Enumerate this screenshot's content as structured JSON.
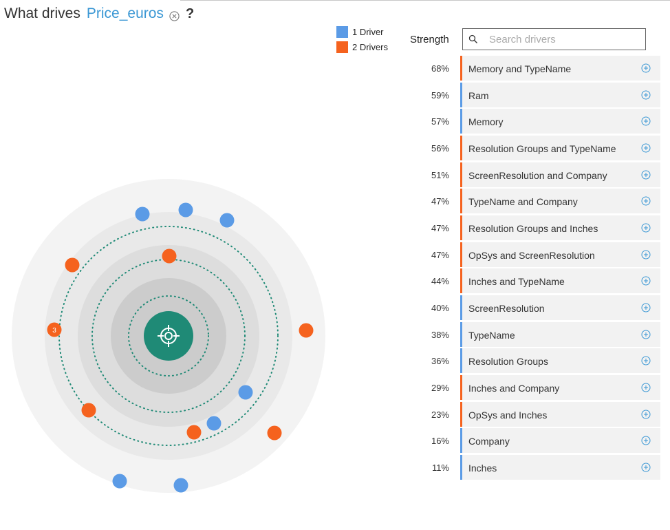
{
  "header": {
    "prefix": "What drives",
    "target": "Price_euros",
    "suffix": "?"
  },
  "legend": [
    {
      "label": "1 Driver",
      "color": "#5b9be6"
    },
    {
      "label": "2 Drivers",
      "color": "#f5621e"
    }
  ],
  "strength_label": "Strength",
  "search": {
    "placeholder": "Search drivers",
    "value": ""
  },
  "colors": {
    "one_driver": "#5b9be6",
    "two_drivers": "#f5621e",
    "target": "#1f8a76",
    "accent": "#3a97d4"
  },
  "drivers": [
    {
      "pct": "68%",
      "name": "Memory and TypeName",
      "count": 2
    },
    {
      "pct": "59%",
      "name": "Ram",
      "count": 1
    },
    {
      "pct": "57%",
      "name": "Memory",
      "count": 1
    },
    {
      "pct": "56%",
      "name": "Resolution Groups and TypeName",
      "count": 2
    },
    {
      "pct": "51%",
      "name": "ScreenResolution and Company",
      "count": 2
    },
    {
      "pct": "47%",
      "name": "TypeName and Company",
      "count": 2
    },
    {
      "pct": "47%",
      "name": "Resolution Groups and Inches",
      "count": 2
    },
    {
      "pct": "47%",
      "name": "OpSys and ScreenResolution",
      "count": 2
    },
    {
      "pct": "44%",
      "name": "Inches and TypeName",
      "count": 2
    },
    {
      "pct": "40%",
      "name": "ScreenResolution",
      "count": 1
    },
    {
      "pct": "38%",
      "name": "TypeName",
      "count": 1
    },
    {
      "pct": "36%",
      "name": "Resolution Groups",
      "count": 1
    },
    {
      "pct": "29%",
      "name": "Inches and Company",
      "count": 2
    },
    {
      "pct": "23%",
      "name": "OpSys and Inches",
      "count": 2
    },
    {
      "pct": "16%",
      "name": "Company",
      "count": 1
    },
    {
      "pct": "11%",
      "name": "Inches",
      "count": 1
    }
  ],
  "cluster_badge": "3"
}
